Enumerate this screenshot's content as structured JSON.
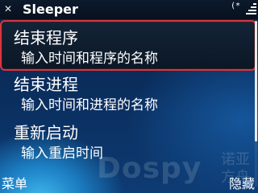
{
  "app": {
    "title": "Sleeper",
    "close_icon": "close-icon",
    "status_lock_glyph": "(*",
    "status_icons": [
      "lock-icon",
      "signal-icon"
    ]
  },
  "menu": {
    "items": [
      {
        "title": "结束程序",
        "subtitle": "输入时间和程序的名称",
        "selected": true
      },
      {
        "title": "结束进程",
        "subtitle": "输入时间和进程的名称",
        "selected": false
      },
      {
        "title": "重新启动",
        "subtitle": "输入重启时间",
        "selected": false
      }
    ]
  },
  "watermark": {
    "brand": "Dospy",
    "cn": "诺亚方舟"
  },
  "softkeys": {
    "left": "菜单",
    "right": "隐藏"
  },
  "colors": {
    "selection_border": "#d8363f",
    "background": "#0a2d5c",
    "accent": "#3fb6ea"
  }
}
